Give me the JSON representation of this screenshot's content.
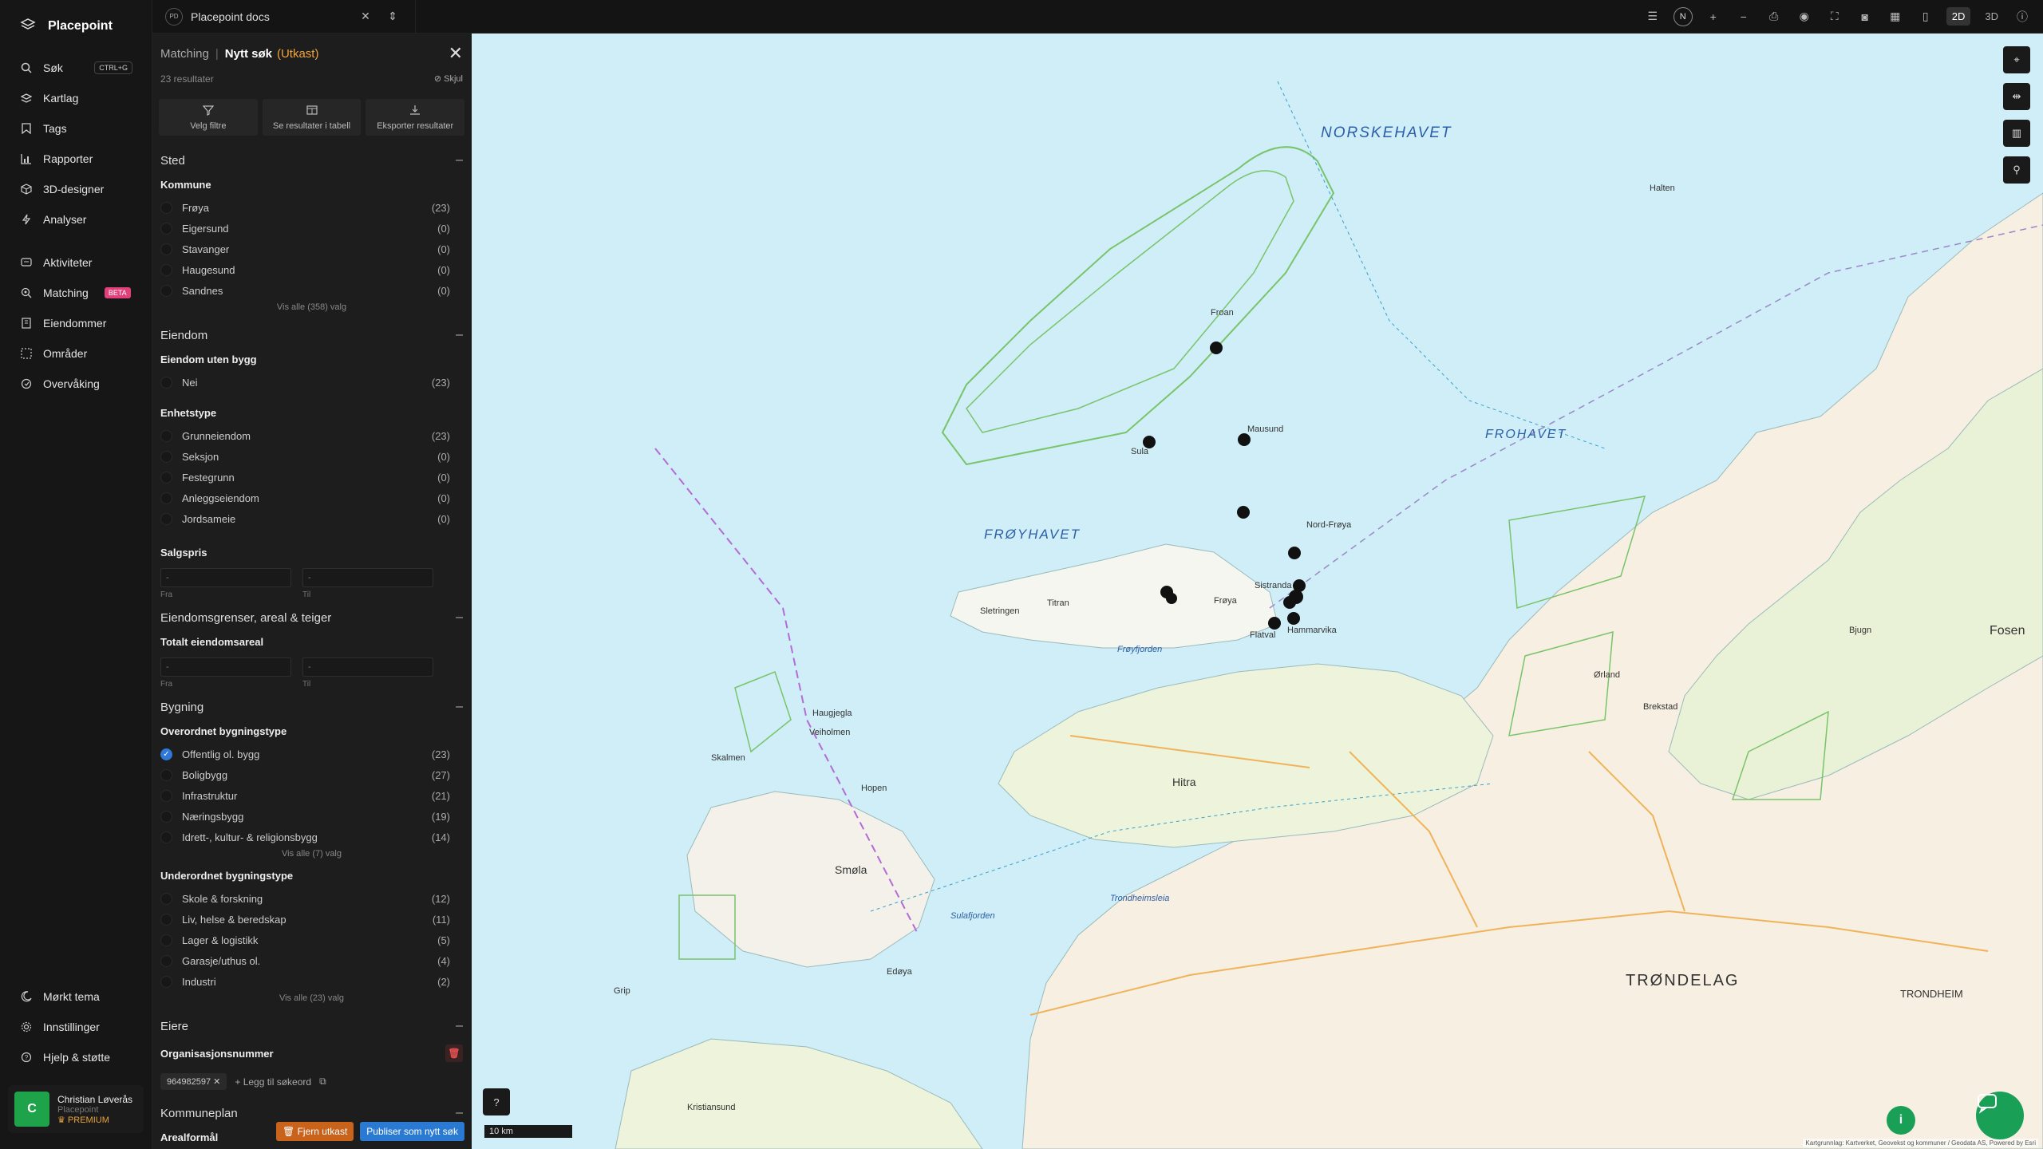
{
  "brand": {
    "name": "Placepoint"
  },
  "nav": {
    "items": [
      {
        "label": "Søk",
        "shortcut": "CTRL+G"
      },
      {
        "label": "Kartlag"
      },
      {
        "label": "Tags"
      },
      {
        "label": "Rapporter"
      },
      {
        "label": "3D-designer"
      },
      {
        "label": "Analyser"
      }
    ],
    "items2": [
      {
        "label": "Aktiviteter"
      },
      {
        "label": "Matching",
        "badge": "BETA"
      },
      {
        "label": "Eiendommer"
      },
      {
        "label": "Områder"
      },
      {
        "label": "Overvåking"
      }
    ],
    "bottom": [
      {
        "label": "Mørkt tema"
      },
      {
        "label": "Innstillinger"
      },
      {
        "label": "Hjelp & støtte"
      }
    ],
    "user": {
      "initial": "C",
      "name": "Christian Løverås",
      "org": "Placepoint",
      "tier": "PREMIUM"
    }
  },
  "topbar": {
    "doc_initials": "PD",
    "doc_name": "Placepoint docs",
    "compass": "N",
    "mode_2d": "2D",
    "mode_3d": "3D"
  },
  "panel": {
    "title": "Matching",
    "subtitle": "Nytt søk",
    "draft": "(Utkast)",
    "results": "23 resultater",
    "hide": "Skjul",
    "actions": [
      "Velg filtre",
      "Se resultater i tabell",
      "Eksporter resultater"
    ],
    "sted": {
      "title": "Sted",
      "kommune_title": "Kommune",
      "kommune": [
        {
          "label": "Frøya",
          "count": "(23)"
        },
        {
          "label": "Eigersund",
          "count": "(0)"
        },
        {
          "label": "Stavanger",
          "count": "(0)"
        },
        {
          "label": "Haugesund",
          "count": "(0)"
        },
        {
          "label": "Sandnes",
          "count": "(0)"
        }
      ],
      "see_all": "Vis alle (358) valg"
    },
    "eiendom": {
      "title": "Eiendom",
      "uten_bygg_title": "Eiendom uten bygg",
      "uten_bygg": [
        {
          "label": "Nei",
          "count": "(23)"
        }
      ],
      "enhetstype_title": "Enhetstype",
      "enhetstype": [
        {
          "label": "Grunneiendom",
          "count": "(23)"
        },
        {
          "label": "Seksjon",
          "count": "(0)"
        },
        {
          "label": "Festegrunn",
          "count": "(0)"
        },
        {
          "label": "Anleggseiendom",
          "count": "(0)"
        },
        {
          "label": "Jordsameie",
          "count": "(0)"
        }
      ],
      "salgspris_title": "Salgspris",
      "from_label": "Fra",
      "to_label": "Til",
      "placeholder": "-"
    },
    "grenser": {
      "title": "Eiendomsgrenser, areal & teiger",
      "areal_title": "Totalt eiendomsareal",
      "from_label": "Fra",
      "to_label": "Til"
    },
    "bygning": {
      "title": "Bygning",
      "overordnet_title": "Overordnet bygningstype",
      "overordnet": [
        {
          "label": "Offentlig ol. bygg",
          "count": "(23)",
          "checked": true
        },
        {
          "label": "Boligbygg",
          "count": "(27)"
        },
        {
          "label": "Infrastruktur",
          "count": "(21)"
        },
        {
          "label": "Næringsbygg",
          "count": "(19)"
        },
        {
          "label": "Idrett-, kultur- & religionsbygg",
          "count": "(14)"
        }
      ],
      "overordnet_see_all": "Vis alle (7) valg",
      "underordnet_title": "Underordnet bygningstype",
      "underordnet": [
        {
          "label": "Skole & forskning",
          "count": "(12)"
        },
        {
          "label": "Liv, helse & beredskap",
          "count": "(11)"
        },
        {
          "label": "Lager & logistikk",
          "count": "(5)"
        },
        {
          "label": "Garasje/uthus ol.",
          "count": "(4)"
        },
        {
          "label": "Industri",
          "count": "(2)"
        }
      ],
      "underordnet_see_all": "Vis alle (23) valg"
    },
    "eiere": {
      "title": "Eiere",
      "org_title": "Organisasjonsnummer",
      "chip": "964982597",
      "add_keyword": "Legg til søkeord"
    },
    "kommuneplan": {
      "title": "Kommuneplan",
      "sub": "Arealformål"
    },
    "footer": {
      "remove": "Fjern utkast",
      "publish": "Publiser som nytt søk"
    }
  },
  "map": {
    "scale": "10 km",
    "attribution": "Kartgrunnlag: Kartverket, Geovekst og kommuner / Geodata AS, Powered by Esri",
    "sea_labels": [
      "NORSKEHAVET",
      "FRØYHAVET",
      "FROHAVET",
      "TRØNDELAG"
    ],
    "places": [
      "Froan",
      "Halten",
      "Mausund",
      "Sula",
      "Nord-Frøya",
      "Frøya",
      "Sistranda",
      "Hammarvika",
      "Titran",
      "Sletringen",
      "Flatval",
      "Frøyfjorden",
      "Hitra",
      "Smøla",
      "Kristiansund",
      "Trondheimsleia",
      "TRONDHEIM",
      "Fosen",
      "Brekstad",
      "Bjugn",
      "Ørland",
      "Grip",
      "Skalmen",
      "Haugjegla",
      "Veiholmen",
      "Hopen",
      "Edøya",
      "Sulafjorden"
    ]
  }
}
